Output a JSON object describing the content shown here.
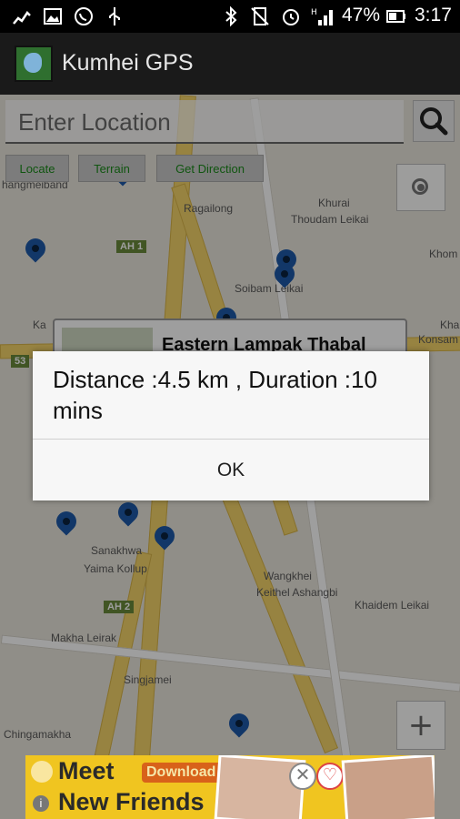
{
  "status_bar": {
    "battery_percent": "47%",
    "time": "3:17",
    "icons": [
      "signal-bars-icon",
      "image-icon",
      "whatsapp-icon",
      "usb-icon",
      "bluetooth-icon",
      "no-sim-icon",
      "alarm-icon",
      "network-h-icon",
      "battery-icon"
    ]
  },
  "app_bar": {
    "title": "Kumhei GPS",
    "logo_icon": "app-logo-icon"
  },
  "search": {
    "placeholder": "Enter Location",
    "search_icon": "search-icon"
  },
  "map_buttons": [
    "Locate",
    "Terrain",
    "Get Direction"
  ],
  "map": {
    "labels": [
      "hangmeiband",
      "Ragailong",
      "Khurai",
      "Thoudam Leikai",
      "Khom",
      "Soibam Leikai",
      "Kha",
      "Ka",
      "Konsam",
      "Sanakhwa",
      "Yaima Kollup",
      "Wangkhei",
      "Keithel Ashangbi",
      "Khaidem Leikai",
      "Makha Leirak",
      "Singjamei",
      "Chingamakha"
    ],
    "road_shields": [
      "AH 1",
      "AH 2",
      "53"
    ],
    "info_window_title": "Eastern Lampak Thabal"
  },
  "controls": {
    "my_location_icon": "my-location-icon",
    "zoom_in": "+"
  },
  "dialog": {
    "message": "Distance :4.5 km , Duration :10 mins",
    "ok_label": "OK"
  },
  "ad": {
    "line1": "Meet",
    "line2": "New Friends",
    "cta": "Download Now",
    "info_glyph": "i",
    "close_glyph": "✕",
    "heart_glyph": "♡"
  },
  "colors": {
    "pin": "#1e5aa8",
    "ad_background": "#f0c520",
    "map_background": "#e9e5dc"
  }
}
